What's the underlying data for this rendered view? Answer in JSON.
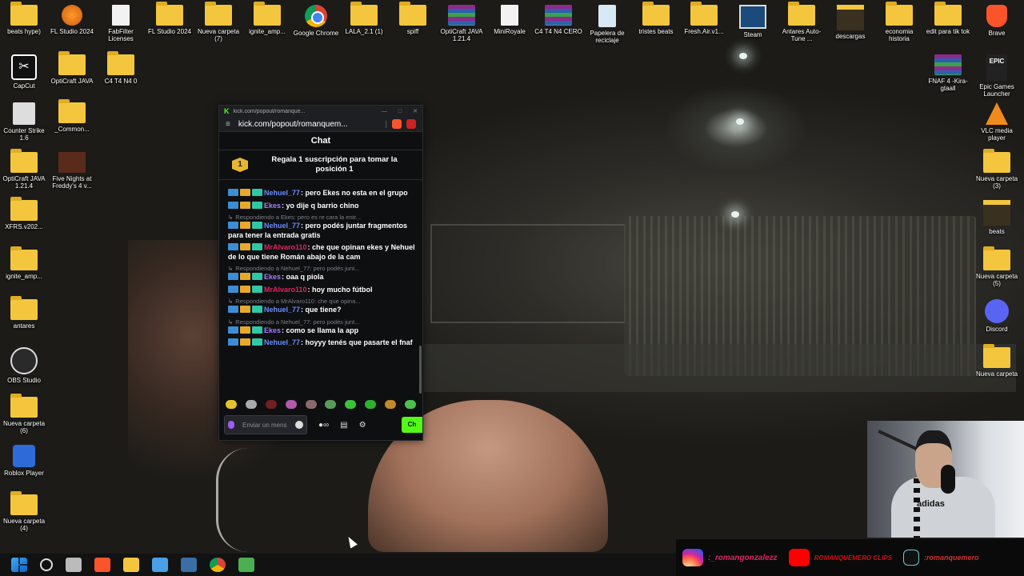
{
  "desktop_icons": [
    {
      "label": "beats hype)",
      "icon": "folder-icon",
      "type": "folder"
    },
    {
      "label": "FL Studio 2024",
      "icon": "fl-studio-icon",
      "type": "flicon"
    },
    {
      "label": "FabFilter Licenses",
      "icon": "document-icon",
      "type": "docf"
    },
    {
      "label": "FL Studio 2024",
      "icon": "folder-icon",
      "type": "folder"
    },
    {
      "label": "Nueva carpeta (7)",
      "icon": "folder-icon",
      "type": "folder"
    },
    {
      "label": "ignite_amp...",
      "icon": "folder-icon",
      "type": "folder"
    },
    {
      "label": "Google Chrome",
      "icon": "chrome-icon",
      "type": "chrome"
    },
    {
      "label": "LALA_2.1 (1)",
      "icon": "folder-icon",
      "type": "folder"
    },
    {
      "label": "spiff",
      "icon": "folder-icon",
      "type": "folder"
    },
    {
      "label": "OptiCraft JAVA 1.21.4",
      "icon": "winrar-icon",
      "type": "rar"
    },
    {
      "label": "MiniRoyale",
      "icon": "document-icon",
      "type": "docf"
    },
    {
      "label": "C4 T4 N4 CERO",
      "icon": "winrar-icon",
      "type": "rar"
    },
    {
      "label": "Papelera de reciclaje",
      "icon": "recycle-bin-icon",
      "type": "bin"
    },
    {
      "label": "tristes beats",
      "icon": "folder-icon",
      "type": "folder"
    },
    {
      "label": "Fresh.Air.v1...",
      "icon": "folder-icon",
      "type": "folder"
    },
    {
      "label": "Steam",
      "icon": "steam-icon",
      "type": "steam"
    },
    {
      "label": "Antares Auto-Tune ...",
      "icon": "folder-icon",
      "type": "folder"
    },
    {
      "label": "descargas",
      "icon": "folder-icon",
      "type": "darkfolder"
    },
    {
      "label": "economia historia",
      "icon": "folder-icon",
      "type": "folder"
    },
    {
      "label": "edit para tik tok",
      "icon": "folder-icon",
      "type": "folder"
    },
    {
      "label": "Brave",
      "icon": "brave-icon",
      "type": "brave"
    },
    {
      "label": "CapCut",
      "icon": "capcut-icon",
      "type": "capcut"
    },
    {
      "label": "OptiCraft JAVA",
      "icon": "folder-icon",
      "type": "folder"
    },
    {
      "label": "C4 T4 N4 0",
      "icon": "folder-icon",
      "type": "folder"
    },
    {
      "label": "FNAF 4 -Kira-gtaall",
      "icon": "winrar-icon",
      "type": "rar"
    },
    {
      "label": "Epic Games Launcher",
      "icon": "epic-games-icon",
      "type": "epic"
    },
    {
      "label": "Counter Strike 1.6",
      "icon": "counter-strike-icon",
      "type": "cs"
    },
    {
      "label": "_Common...",
      "icon": "folder-icon",
      "type": "folder"
    },
    {
      "label": "VLC media player",
      "icon": "vlc-icon",
      "type": "vlc"
    },
    {
      "label": "OptiCraft JAVA 1.21.4",
      "icon": "folder-icon",
      "type": "folder"
    },
    {
      "label": "Five Nights at Freddy's 4 v...",
      "icon": "fnaf-icon",
      "type": "fnaf"
    },
    {
      "label": "Nueva carpeta (3)",
      "icon": "folder-icon",
      "type": "folder"
    },
    {
      "label": "XFRS.v202...",
      "icon": "folder-icon",
      "type": "folder"
    },
    {
      "label": "beats",
      "icon": "folder-icon",
      "type": "darkfolder"
    },
    {
      "label": "ignite_amp...",
      "icon": "folder-icon",
      "type": "folder"
    },
    {
      "label": "Nueva carpeta (5)",
      "icon": "folder-icon",
      "type": "folder"
    },
    {
      "label": "antares",
      "icon": "folder-icon",
      "type": "folder"
    },
    {
      "label": "Discord",
      "icon": "discord-icon",
      "type": "discord"
    },
    {
      "label": "OBS Studio",
      "icon": "obs-icon",
      "type": "obs"
    },
    {
      "label": "Nueva carpeta",
      "icon": "folder-icon",
      "type": "folder"
    },
    {
      "label": "Nueva carpeta (6)",
      "icon": "folder-icon",
      "type": "folder"
    },
    {
      "label": "Roblox Player",
      "icon": "roblox-icon",
      "type": "roblox"
    },
    {
      "label": "Nueva carpeta (4)",
      "icon": "folder-icon",
      "type": "folder"
    }
  ],
  "chat_window": {
    "title": "kick.com/popout/romanque...",
    "url": "kick.com/popout/romanquem...",
    "header": "Chat",
    "pinned_badge": "1",
    "pinned_text": "Regala 1 suscripción para tomar la posición 1",
    "messages": [
      {
        "reply": "",
        "user": "Nehuel_77",
        "user_color": "#6b8cff",
        "text": ": pero Ekes no esta en el grupo"
      },
      {
        "reply": "",
        "user": "Ekes",
        "user_color": "#a77dff",
        "text": ": yo dije q barrio chino"
      },
      {
        "reply": "Respondiendo a Ekes: pero es re cara la entr...",
        "user": "Nehuel_77",
        "user_color": "#6b8cff",
        "text": ": pero podés juntar fragmentos para tener la entrada gratis"
      },
      {
        "reply": "",
        "user": "MrAlvaro110",
        "user_color": "#e0245e",
        "text": ": che que opinan ekes y Nehuel de lo que tiene Román abajo de la cam"
      },
      {
        "reply": "Respondiendo a Nehuel_77: pero podés junt...",
        "user": "Ekes",
        "user_color": "#a77dff",
        "text": ": oaa q piola"
      },
      {
        "reply": "",
        "user": "MrAlvaro110",
        "user_color": "#e0245e",
        "text": ": hoy mucho fútbol"
      },
      {
        "reply": "Respondiendo a MrAlvaro110: che que opina...",
        "user": "Nehuel_77",
        "user_color": "#6b8cff",
        "text": ": que tiene?"
      },
      {
        "reply": "Respondiendo a Nehuel_77: pero podés junt...",
        "user": "Ekes",
        "user_color": "#a77dff",
        "text": ": como se llama la app"
      },
      {
        "reply": "",
        "user": "Nehuel_77",
        "user_color": "#6b8cff",
        "text": ": hoyyy tenés que pasarte el fnaf"
      }
    ],
    "input_placeholder": "Enviar un mensaje",
    "send_label": "Ch"
  },
  "socials": {
    "instagram": ":_romangonzalezz",
    "youtube": "ROMANQUEMERO CLIPS",
    "tiktok": ":romanquemero"
  },
  "webcam_brand": "adidas",
  "taskbar": [
    "windows-start-icon",
    "search-icon",
    "task-view-icon",
    "brave-icon",
    "file-explorer-icon",
    "store-icon",
    "calculator-icon",
    "chrome-icon",
    "green-app-icon"
  ]
}
